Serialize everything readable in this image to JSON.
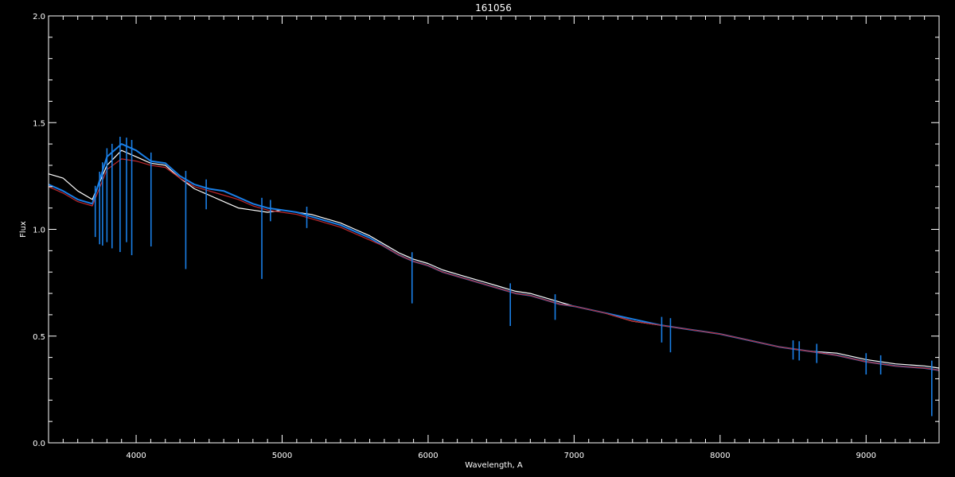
{
  "chart_data": {
    "type": "line",
    "title": "161056",
    "xlabel": "Wavelength, A",
    "ylabel": "Flux",
    "xlim": [
      3400,
      9500
    ],
    "ylim": [
      0.0,
      2.0
    ],
    "x_ticks": [
      {
        "value": 4000,
        "label": "4000"
      },
      {
        "value": 5000,
        "label": "5000"
      },
      {
        "value": 6000,
        "label": "6000"
      },
      {
        "value": 7000,
        "label": "7000"
      },
      {
        "value": 8000,
        "label": "8000"
      },
      {
        "value": 9000,
        "label": "9000"
      }
    ],
    "y_ticks": [
      {
        "value": 0.0,
        "label": "0.0"
      },
      {
        "value": 0.5,
        "label": "0.5"
      },
      {
        "value": 1.0,
        "label": "1.0"
      },
      {
        "value": 1.5,
        "label": "1.5"
      },
      {
        "value": 2.0,
        "label": "2.0"
      }
    ],
    "x_minor_step": 100,
    "y_minor_step": 0.1,
    "grid": false,
    "series": [
      {
        "color": "#ffffff",
        "x": [
          3400,
          3500,
          3600,
          3700,
          3800,
          3900,
          4000,
          4100,
          4200,
          4300,
          4400,
          4500,
          4600,
          4700,
          4800,
          4900,
          5000,
          5100,
          5200,
          5300,
          5400,
          5500,
          5600,
          5700,
          5800,
          5900,
          6000,
          6100,
          6200,
          6300,
          6400,
          6500,
          6600,
          6700,
          6800,
          6900,
          7000,
          7200,
          7400,
          7600,
          7800,
          8000,
          8200,
          8400,
          8600,
          8800,
          9000,
          9200,
          9400,
          9500
        ],
        "y": [
          1.26,
          1.24,
          1.18,
          1.14,
          1.3,
          1.37,
          1.34,
          1.31,
          1.3,
          1.24,
          1.19,
          1.16,
          1.13,
          1.1,
          1.09,
          1.08,
          1.09,
          1.08,
          1.07,
          1.05,
          1.03,
          1.0,
          0.97,
          0.93,
          0.89,
          0.86,
          0.84,
          0.81,
          0.79,
          0.77,
          0.75,
          0.73,
          0.71,
          0.7,
          0.68,
          0.66,
          0.64,
          0.61,
          0.57,
          0.55,
          0.53,
          0.51,
          0.48,
          0.45,
          0.43,
          0.42,
          0.39,
          0.37,
          0.36,
          0.35
        ]
      },
      {
        "color": "#1a7fe6",
        "x": [
          3400,
          3500,
          3600,
          3700,
          3800,
          3900,
          4000,
          4100,
          4200,
          4300,
          4400,
          4500,
          4600,
          4700,
          4800,
          4900,
          5000,
          5100,
          5200,
          5300,
          5400,
          5500,
          5600,
          5700,
          5800,
          5900,
          6000,
          6100,
          6200,
          6300,
          6400,
          6500,
          6600,
          6700,
          6800,
          6900,
          7000,
          7200,
          7400,
          7600,
          7800,
          8000,
          8200,
          8400,
          8600,
          8800,
          9000,
          9200,
          9400,
          9500
        ],
        "y": [
          1.21,
          1.18,
          1.14,
          1.12,
          1.34,
          1.4,
          1.37,
          1.32,
          1.31,
          1.25,
          1.21,
          1.19,
          1.18,
          1.15,
          1.12,
          1.1,
          1.09,
          1.08,
          1.06,
          1.04,
          1.02,
          0.99,
          0.96,
          0.92,
          0.88,
          0.85,
          0.83,
          0.8,
          0.78,
          0.76,
          0.74,
          0.72,
          0.7,
          0.69,
          0.67,
          0.65,
          0.64,
          0.61,
          0.58,
          0.55,
          0.53,
          0.51,
          0.48,
          0.45,
          0.43,
          0.41,
          0.38,
          0.36,
          0.35,
          0.34
        ]
      },
      {
        "color": "#c0282d",
        "x": [
          3400,
          3500,
          3600,
          3700,
          3800,
          3900,
          4000,
          4100,
          4200,
          4300,
          4400,
          4500,
          4600,
          4700,
          4800,
          4900,
          5000,
          5100,
          5200,
          5300,
          5400,
          5500,
          5600,
          5700,
          5800,
          5900,
          6000,
          6100,
          6200,
          6300,
          6400,
          6500,
          6600,
          6700,
          6800,
          6900,
          7000,
          7200,
          7400,
          7600,
          7800,
          8000,
          8200,
          8400,
          8600,
          8800,
          9000,
          9200,
          9400,
          9500
        ],
        "y": [
          1.2,
          1.17,
          1.13,
          1.11,
          1.28,
          1.33,
          1.32,
          1.3,
          1.29,
          1.24,
          1.2,
          1.18,
          1.16,
          1.14,
          1.11,
          1.09,
          1.08,
          1.07,
          1.05,
          1.03,
          1.01,
          0.98,
          0.95,
          0.92,
          0.88,
          0.85,
          0.83,
          0.8,
          0.78,
          0.76,
          0.74,
          0.72,
          0.7,
          0.69,
          0.67,
          0.65,
          0.64,
          0.61,
          0.57,
          0.55,
          0.53,
          0.51,
          0.48,
          0.45,
          0.43,
          0.41,
          0.38,
          0.36,
          0.35,
          0.34
        ]
      }
    ],
    "absorption_lines": [
      {
        "x": 3720,
        "depth": 0.2
      },
      {
        "x": 3750,
        "depth": 0.3
      },
      {
        "x": 3770,
        "depth": 0.35
      },
      {
        "x": 3800,
        "depth": 0.4
      },
      {
        "x": 3835,
        "depth": 0.45
      },
      {
        "x": 3890,
        "depth": 0.5
      },
      {
        "x": 3934,
        "depth": 0.45
      },
      {
        "x": 3970,
        "depth": 0.5
      },
      {
        "x": 4102,
        "depth": 0.4
      },
      {
        "x": 4340,
        "depth": 0.42
      },
      {
        "x": 4480,
        "depth": 0.1
      },
      {
        "x": 4861,
        "depth": 0.34
      },
      {
        "x": 4920,
        "depth": 0.06
      },
      {
        "x": 5169,
        "depth": 0.06
      },
      {
        "x": 5890,
        "depth": 0.2
      },
      {
        "x": 6563,
        "depth": 0.16
      },
      {
        "x": 6870,
        "depth": 0.08
      },
      {
        "x": 7600,
        "depth": 0.08
      },
      {
        "x": 7660,
        "depth": 0.12
      },
      {
        "x": 8500,
        "depth": 0.05
      },
      {
        "x": 8542,
        "depth": 0.05
      },
      {
        "x": 8662,
        "depth": 0.05
      },
      {
        "x": 9000,
        "depth": 0.06
      },
      {
        "x": 9100,
        "depth": 0.05
      },
      {
        "x": 9450,
        "depth": 0.22
      }
    ]
  }
}
